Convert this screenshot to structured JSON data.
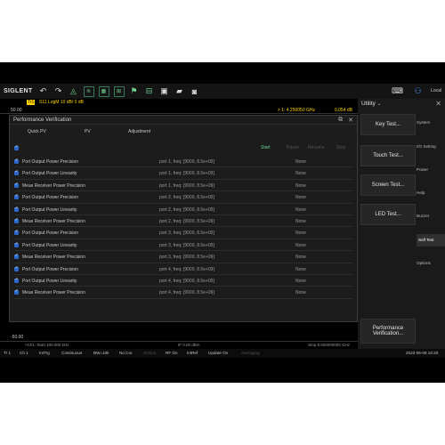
{
  "toolbar": {
    "brand": "SIGLENT",
    "mode": "Local"
  },
  "trace": {
    "tag": "Tr1",
    "desc": "S11 LogM 10 dB/ 0 dB",
    "ytop": "50.00",
    "ybottom": "-50.00",
    "marker_freq": "> 1:  4.250050 GHz",
    "marker_val": "0.054 dB"
  },
  "dialog": {
    "title": "Performance Verification",
    "tabs": [
      "Quick PV",
      "PV",
      "Adjustment"
    ],
    "buttons": {
      "start": "Start",
      "pause": "Pause",
      "resume": "Resume",
      "stop": "Stop"
    },
    "rows": [
      {
        "name": "Port Output Power Precision",
        "param": "port 1, freq: [9000, 8.5e+09]",
        "result": "None"
      },
      {
        "name": "Port Output Power Linearity",
        "param": "port 1, freq: [9000, 8.5e+09]",
        "result": "None"
      },
      {
        "name": "Meas Receiver Power Precision",
        "param": "port 1, freq: [9000, 8.5e+09]",
        "result": "None"
      },
      {
        "name": "Port Output Power Precision",
        "param": "port 2, freq: [9000, 8.5e+09]",
        "result": "None"
      },
      {
        "name": "Port Output Power Linearity",
        "param": "port 2, freq: [9000, 8.5e+09]",
        "result": "None"
      },
      {
        "name": "Meas Receiver Power Precision",
        "param": "port 2, freq: [9000, 8.5e+09]",
        "result": "None"
      },
      {
        "name": "Port Output Power Precision",
        "param": "port 3, freq: [9000, 8.5e+09]",
        "result": "None"
      },
      {
        "name": "Port Output Power Linearity",
        "param": "port 3, freq: [9000, 8.5e+09]",
        "result": "None"
      },
      {
        "name": "Meas Receiver Power Precision",
        "param": "port 3, freq: [9000, 8.5e+09]",
        "result": "None"
      },
      {
        "name": "Port Output Power Precision",
        "param": "port 4, freq: [9000, 8.5e+09]",
        "result": "None"
      },
      {
        "name": "Port Output Power Linearity",
        "param": "port 4, freq: [9000, 8.5e+09]",
        "result": "None"
      },
      {
        "name": "Meas Receiver Power Precision",
        "param": "port 4, freq: [9000, 8.5e+09]",
        "result": "None"
      }
    ]
  },
  "status": {
    "start": ">Ch1: Start 100.000 kHz",
    "power": "IF 0.00 dBm",
    "stop": "Stop 8.500000000 GHz"
  },
  "bottombar": {
    "tr": "Tr 1",
    "ch": "Ch 1",
    "trig": "IntTrg",
    "sweep": "Continuous",
    "bw": "BW=10k",
    "cor": "No Cor",
    "smo": "SmCal",
    "rf": "RF On",
    "ref": "IntRef",
    "update": "Update On",
    "avg": "Averaging",
    "datetime": "2023-05-08 16:20"
  },
  "panel": {
    "title": "Utility",
    "buttons": [
      "Key Test...",
      "Touch Test...",
      "Screen Test...",
      "LED Test...",
      "Performance Verification..."
    ],
    "side": [
      "System",
      "I/O Setting",
      "Power",
      "Help",
      "Buzzer",
      "Self Test",
      "Options"
    ],
    "active_side": "Self Test"
  },
  "colors": {
    "accent": "#ffd400",
    "checkbox": "#2b66c9",
    "background": "#000000"
  }
}
